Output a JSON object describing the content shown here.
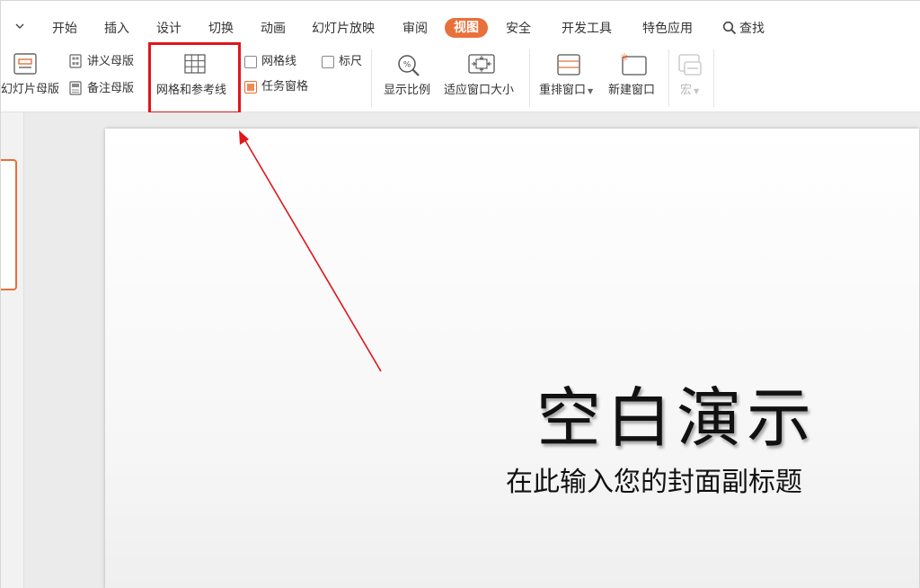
{
  "menu": {
    "tabs": [
      {
        "label": "开始"
      },
      {
        "label": "插入"
      },
      {
        "label": "设计"
      },
      {
        "label": "切换"
      },
      {
        "label": "动画"
      },
      {
        "label": "幻灯片放映"
      },
      {
        "label": "审阅"
      },
      {
        "label": "视图",
        "active": true
      },
      {
        "label": "安全"
      },
      {
        "label": "开发工具"
      },
      {
        "label": "特色应用"
      }
    ],
    "search_label": "查找",
    "accent_color": "#e8703a"
  },
  "ribbon": {
    "slide_master_label": "幻灯片母版",
    "handout_master_label": "讲义母版",
    "notes_master_label": "备注母版",
    "grid_guides_label": "网格和参考线",
    "gridlines_label": "网格线",
    "ruler_label": "标尺",
    "task_pane_label": "任务窗格",
    "zoom_label": "显示比例",
    "fit_window_label": "适应窗口大小",
    "arrange_windows_label": "重排窗口",
    "new_window_label": "新建窗口",
    "macro_label": "宏",
    "gridlines_checked": false,
    "ruler_checked": false,
    "task_pane_checked": true
  },
  "slide": {
    "title": "空白演示",
    "subtitle": "在此输入您的封面副标题"
  },
  "annotation": {
    "highlight_color": "#e0161b"
  }
}
